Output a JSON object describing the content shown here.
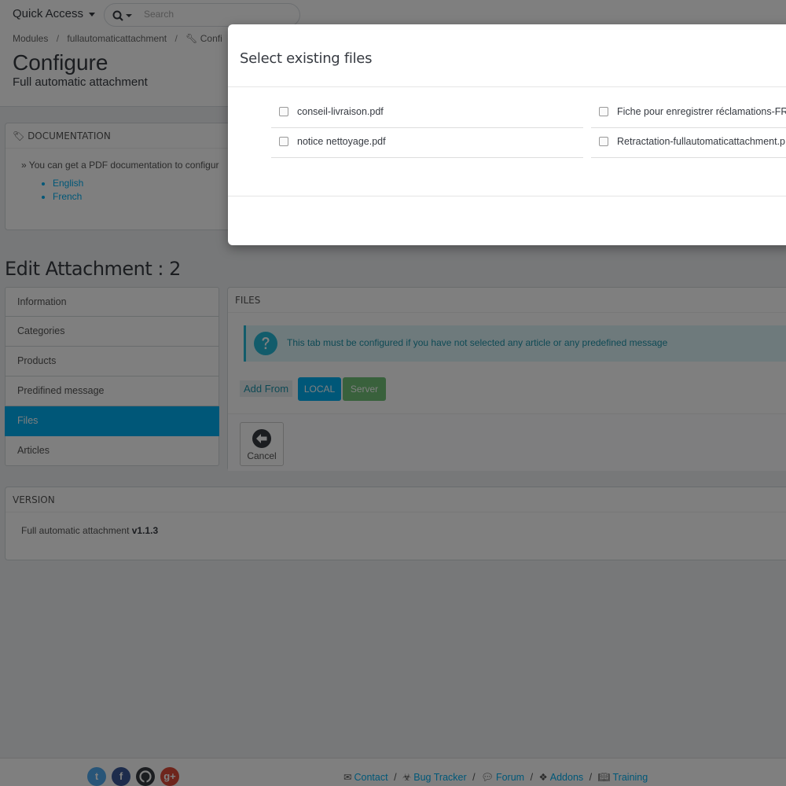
{
  "header": {
    "quick_access": "Quick Access",
    "search_placeholder": "Search"
  },
  "breadcrumb": [
    "Modules",
    "fullautomaticattachment",
    "Confi"
  ],
  "page": {
    "title": "Configure",
    "subtitle": "Full automatic attachment"
  },
  "documentation": {
    "heading": "DOCUMENTATION",
    "text": "» You can get a PDF documentation to configur",
    "links": [
      "English",
      "French"
    ]
  },
  "edit": {
    "title": "Edit Attachment : 2",
    "tabs": [
      "Information",
      "Categories",
      "Products",
      "Predifined message",
      "Files",
      "Articles"
    ],
    "active_tab": "Files"
  },
  "files_panel": {
    "heading": "FILES",
    "alert": "This tab must be configured if you have not selected any article or any predefined message",
    "add_from": "Add From",
    "local_button": "LOCAL",
    "server_button": "Server",
    "cancel_button": "Cancel"
  },
  "version": {
    "heading": "VERSION",
    "text": "Full automatic attachment",
    "number": "v1.1.3"
  },
  "footer": {
    "social": [
      "twitter-icon",
      "facebook-icon",
      "github-icon",
      "google-plus-icon"
    ],
    "links": [
      "Contact",
      "Bug Tracker",
      "Forum",
      "Addons",
      "Training"
    ]
  },
  "modal": {
    "title": "Select existing files",
    "files": [
      "conseil-livraison.pdf",
      "Fiche pour enregistrer réclamations-FR",
      "notice nettoyage.pdf",
      "Retractation-fullautomaticattachment.p"
    ]
  },
  "colors": {
    "primary": "#00aff0",
    "success": "#72c279",
    "info_bg": "#dcf4f9",
    "info_text": "#1e94ab",
    "overlay": "rgba(0,0,0,0.5)"
  }
}
